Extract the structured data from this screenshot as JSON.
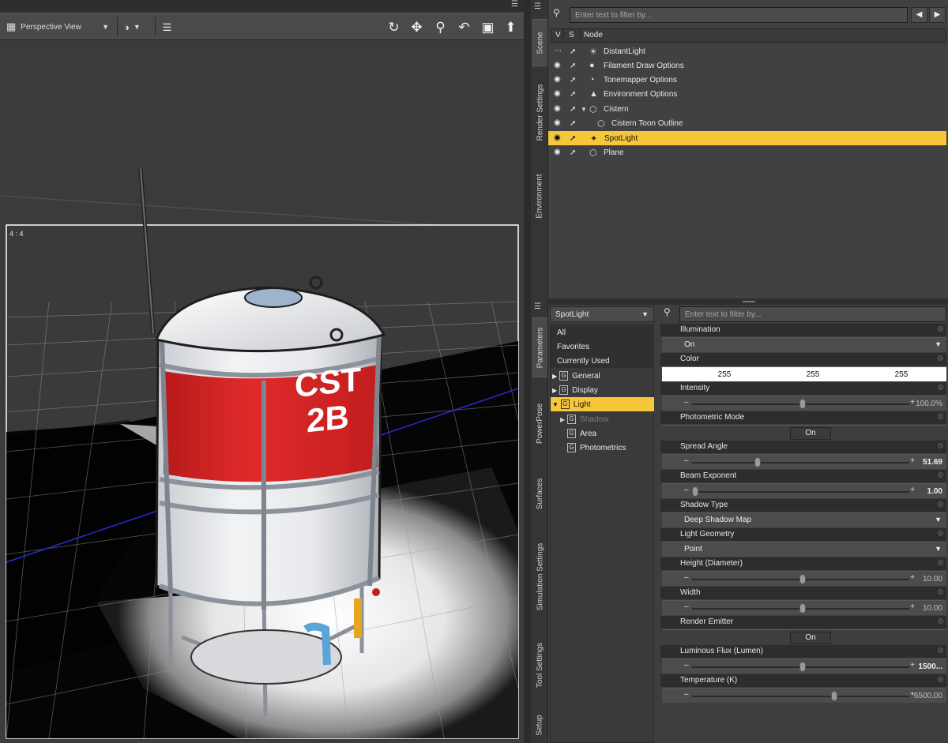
{
  "viewport": {
    "camera_select": "Perspective View",
    "aspect_label": "4 : 4",
    "toolbar_icons": [
      "orbit-icon",
      "pan-icon",
      "zoom-icon",
      "rotate-icon",
      "frame-icon",
      "aim-icon"
    ]
  },
  "tank": {
    "label_line1": "CST",
    "label_line2": "2B"
  },
  "side_tabs_top": [
    "Scene",
    "Render Settings",
    "Environment"
  ],
  "side_tabs_bottom": [
    "Parameters",
    "PowerPose",
    "Surfaces",
    "Simulation Settings",
    "Tool Settings",
    "Setup"
  ],
  "scene": {
    "filter_placeholder": "Enter text to filter by...",
    "col_v": "V",
    "col_s": "S",
    "col_node": "Node",
    "nodes": [
      {
        "label": "DistantLight",
        "icon": "distant-light-icon"
      },
      {
        "label": "Filament Draw Options",
        "icon": "draw-options-icon"
      },
      {
        "label": "Tonemapper Options",
        "icon": "tonemapper-icon"
      },
      {
        "label": "Environment Options",
        "icon": "environment-icon"
      },
      {
        "label": "Cistern",
        "icon": "figure-icon"
      },
      {
        "label": "Cistern Toon Outline",
        "icon": "figure-icon"
      },
      {
        "label": "SpotLight",
        "icon": "spotlight-icon"
      },
      {
        "label": "Plane",
        "icon": "figure-icon"
      }
    ]
  },
  "params": {
    "node_select": "SpotLight",
    "filter_placeholder": "Enter text to filter by...",
    "groups": [
      "All",
      "Favorites",
      "Currently Used",
      "General",
      "Display",
      "Light",
      "Shadow",
      "Area",
      "Photometrics"
    ],
    "illumination": {
      "label": "Illumination",
      "value": "On"
    },
    "color": {
      "label": "Color",
      "r": "255",
      "g": "255",
      "b": "255"
    },
    "intensity": {
      "label": "Intensity",
      "value": "100.0%",
      "fraction": 0.5
    },
    "photometric": {
      "label": "Photometric Mode",
      "value": "On"
    },
    "spread": {
      "label": "Spread Angle",
      "value": "51.69",
      "fraction": 0.29
    },
    "beam": {
      "label": "Beam Exponent",
      "value": "1.00",
      "fraction": 0.0
    },
    "shadow_type": {
      "label": "Shadow Type",
      "value": "Deep Shadow Map"
    },
    "light_geometry": {
      "label": "Light Geometry",
      "value": "Point"
    },
    "height": {
      "label": "Height (Diameter)",
      "value": "10.00",
      "fraction": 0.5
    },
    "width": {
      "label": "Width",
      "value": "10.00",
      "fraction": 0.5
    },
    "render_emitter": {
      "label": "Render Emitter",
      "value": "On"
    },
    "flux": {
      "label": "Luminous Flux (Lumen)",
      "value": "1500...",
      "fraction": 0.5
    },
    "temperature": {
      "label": "Temperature (K)",
      "value": "6500.00",
      "fraction": 0.65
    }
  }
}
